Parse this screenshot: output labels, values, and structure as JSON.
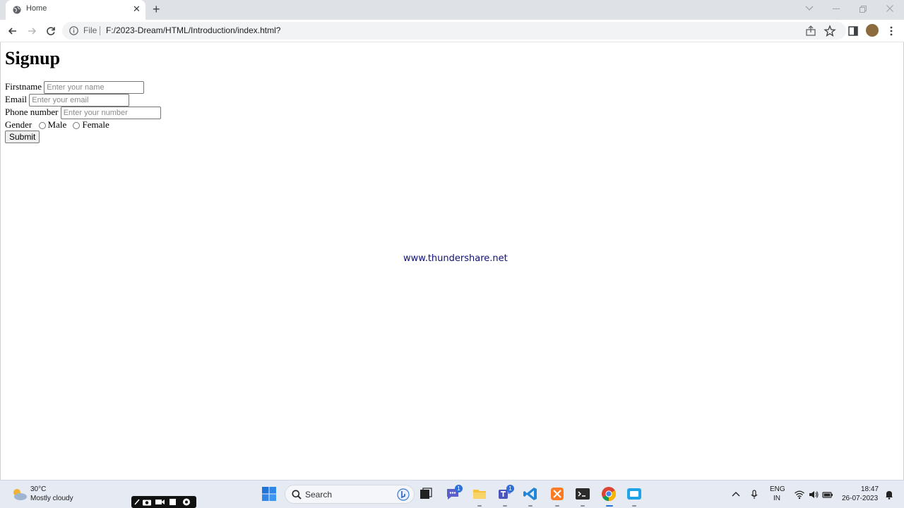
{
  "browser": {
    "tab_title": "Home",
    "address": {
      "scheme_label": "File",
      "url": "F:/2023-Dream/HTML/Introduction/index.html?"
    }
  },
  "page": {
    "heading": "Signup",
    "form": {
      "firstname_label": "Firstname",
      "firstname_placeholder": "Enter your name",
      "email_label": "Email",
      "email_placeholder": "Enter your email",
      "phone_label": "Phone number",
      "phone_placeholder": "Enter your number",
      "gender_label": "Gender",
      "gender_options": [
        "Male",
        "Female"
      ],
      "submit_label": "Submit"
    },
    "watermark": "www.thundershare.net"
  },
  "taskbar": {
    "weather": {
      "temp": "30°C",
      "condition": "Mostly cloudy"
    },
    "search_label": "Search",
    "badges": {
      "chat": "1",
      "teams": "1"
    },
    "language": {
      "line1": "ENG",
      "line2": "IN"
    },
    "clock": {
      "time": "18:47",
      "date": "26-07-2023"
    }
  },
  "colors": {
    "tab_strip": "#dee1e6",
    "watermark": "#10107a",
    "taskbar": "#e6ebf3"
  }
}
